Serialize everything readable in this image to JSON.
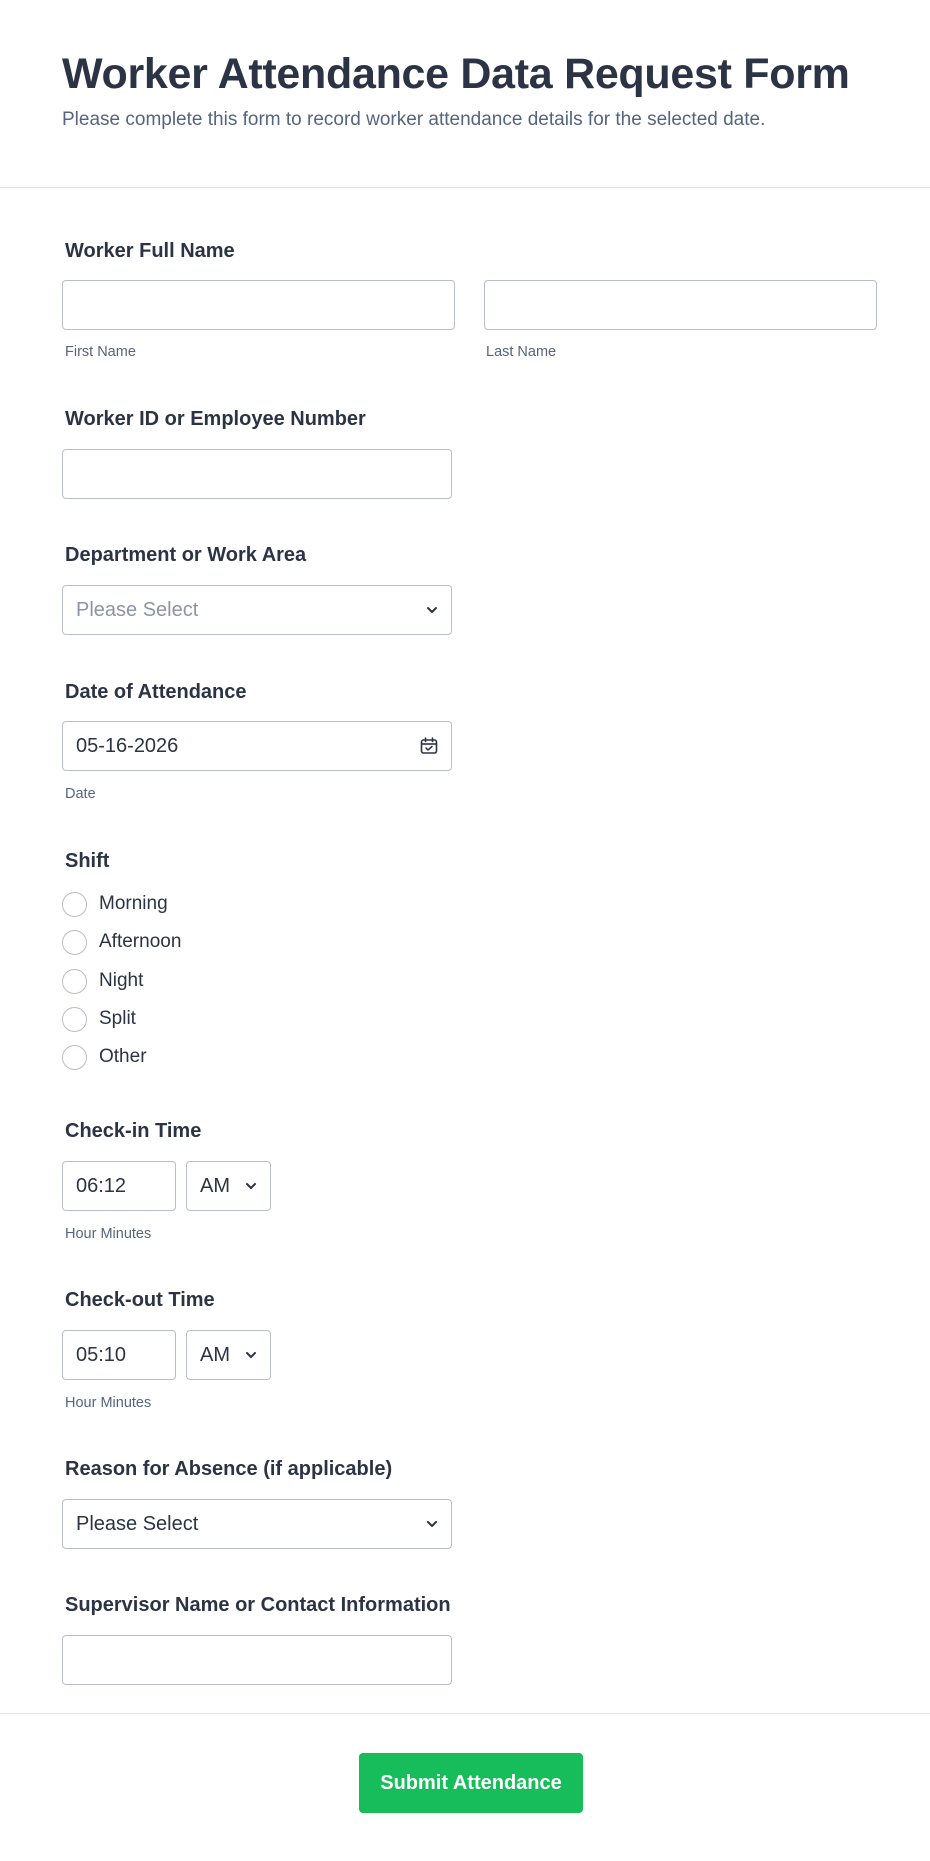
{
  "form": {
    "title": "Worker Attendance Data Request Form",
    "subtitle": "Please complete this form to record worker attendance details for the selected date."
  },
  "full_name": {
    "label": "Worker Full Name",
    "first": {
      "value": "",
      "sublabel": "First Name"
    },
    "last": {
      "value": "",
      "sublabel": "Last Name"
    }
  },
  "worker_id": {
    "label": "Worker ID or Employee Number",
    "value": ""
  },
  "department": {
    "label": "Department or Work Area",
    "selected": "Please Select",
    "icon": "chevron-down-icon"
  },
  "date": {
    "label": "Date of Attendance",
    "value": "05-16-2026",
    "sublabel": "Date",
    "icon": "calendar-icon"
  },
  "shift": {
    "label": "Shift",
    "options": [
      "Morning",
      "Afternoon",
      "Night",
      "Split",
      "Other"
    ]
  },
  "checkin": {
    "label": "Check-in Time",
    "time": "06:12",
    "ampm": "AM",
    "sublabel": "Hour Minutes"
  },
  "checkout": {
    "label": "Check-out Time",
    "time": "05:10",
    "ampm": "AM",
    "sublabel": "Hour Minutes"
  },
  "absence": {
    "label": "Reason for Absence (if applicable)",
    "selected": "Please Select"
  },
  "supervisor": {
    "label": "Supervisor Name or Contact Information",
    "value": ""
  },
  "submit": {
    "label": "Submit Attendance"
  },
  "colors": {
    "accent": "#18bd5b",
    "text": "#2c3345",
    "muted": "#57647e",
    "border": "#b8bdc9"
  }
}
